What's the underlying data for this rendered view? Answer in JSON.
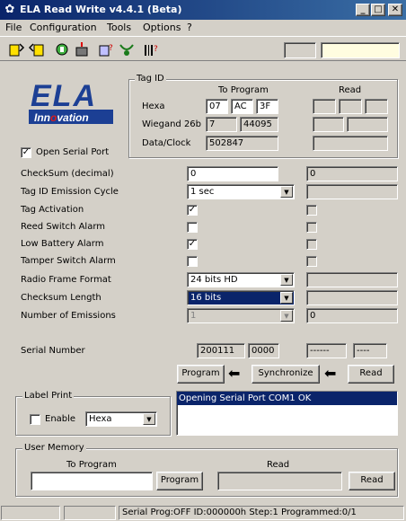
{
  "window": {
    "title": "ELA Read Write v4.4.1 (Beta)",
    "minimize": "_",
    "maximize": "□",
    "close": "✕"
  },
  "menu": [
    "File",
    "Configuration",
    "Tools",
    "Options",
    "?"
  ],
  "logo": {
    "line1": "ELA",
    "line2": "Innovation"
  },
  "tag_id": {
    "title": "Tag ID",
    "to_program_header": "To Program",
    "read_header": "Read",
    "hexa_label": "Hexa",
    "hexa_values": [
      "07",
      "AC",
      "3F"
    ],
    "wiegand_label": "Wiegand 26b",
    "wiegand_values": [
      "7",
      "44095"
    ],
    "dataclock_label": "Data/Clock",
    "dataclock_value": "502847"
  },
  "open_serial_port": {
    "label": "Open Serial Port",
    "checked": "✓"
  },
  "settings": {
    "checksum_label": "CheckSum (decimal)",
    "checksum_value": "0",
    "checksum_read": "0",
    "emission_cycle_label": "Tag ID Emission Cycle",
    "emission_cycle_value": "1 sec",
    "tag_activation_label": "Tag Activation",
    "reed_switch_label": "Reed Switch Alarm",
    "low_battery_label": "Low Battery Alarm",
    "tamper_label": "Tamper Switch Alarm",
    "radio_frame_label": "Radio Frame Format",
    "radio_frame_value": "24 bits HD",
    "checksum_length_label": "Checksum Length",
    "checksum_length_value": "16 bits",
    "num_emissions_label": "Number of Emissions",
    "num_emissions_value": "1",
    "num_emissions_read": "0",
    "check_mark": "✓"
  },
  "serial_number": {
    "label": "Serial Number",
    "value1": "200111",
    "value2": "0000",
    "read1": "------",
    "read2": "----"
  },
  "actions": {
    "program": "Program",
    "synchronize": "Synchronize",
    "read": "Read",
    "arrow": "⬅"
  },
  "label_print": {
    "title": "Label Print",
    "enable_label": "Enable",
    "format_value": "Hexa"
  },
  "log": {
    "line1": "Opening Serial Port COM1 OK"
  },
  "user_memory": {
    "title": "User Memory",
    "to_program_header": "To Program",
    "read_header": "Read",
    "program_button": "Program",
    "read_button": "Read"
  },
  "status": {
    "main": "Serial Prog:OFF ID:000000h Step:1   Programmed:0/1"
  },
  "colors": {
    "titlebar": "#0a246a",
    "selection": "#0a246a",
    "logo_blue": "#1c3f94",
    "logo_red": "#d81e1e"
  }
}
